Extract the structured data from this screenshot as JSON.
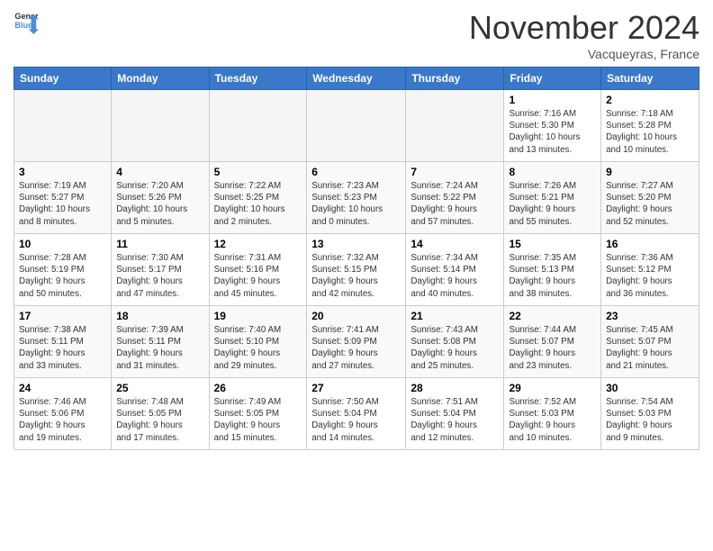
{
  "header": {
    "logo_general": "General",
    "logo_blue": "Blue",
    "month_title": "November 2024",
    "location": "Vacqueyras, France"
  },
  "weekdays": [
    "Sunday",
    "Monday",
    "Tuesday",
    "Wednesday",
    "Thursday",
    "Friday",
    "Saturday"
  ],
  "weeks": [
    [
      {
        "day": "",
        "info": ""
      },
      {
        "day": "",
        "info": ""
      },
      {
        "day": "",
        "info": ""
      },
      {
        "day": "",
        "info": ""
      },
      {
        "day": "",
        "info": ""
      },
      {
        "day": "1",
        "info": "Sunrise: 7:16 AM\nSunset: 5:30 PM\nDaylight: 10 hours\nand 13 minutes."
      },
      {
        "day": "2",
        "info": "Sunrise: 7:18 AM\nSunset: 5:28 PM\nDaylight: 10 hours\nand 10 minutes."
      }
    ],
    [
      {
        "day": "3",
        "info": "Sunrise: 7:19 AM\nSunset: 5:27 PM\nDaylight: 10 hours\nand 8 minutes."
      },
      {
        "day": "4",
        "info": "Sunrise: 7:20 AM\nSunset: 5:26 PM\nDaylight: 10 hours\nand 5 minutes."
      },
      {
        "day": "5",
        "info": "Sunrise: 7:22 AM\nSunset: 5:25 PM\nDaylight: 10 hours\nand 2 minutes."
      },
      {
        "day": "6",
        "info": "Sunrise: 7:23 AM\nSunset: 5:23 PM\nDaylight: 10 hours\nand 0 minutes."
      },
      {
        "day": "7",
        "info": "Sunrise: 7:24 AM\nSunset: 5:22 PM\nDaylight: 9 hours\nand 57 minutes."
      },
      {
        "day": "8",
        "info": "Sunrise: 7:26 AM\nSunset: 5:21 PM\nDaylight: 9 hours\nand 55 minutes."
      },
      {
        "day": "9",
        "info": "Sunrise: 7:27 AM\nSunset: 5:20 PM\nDaylight: 9 hours\nand 52 minutes."
      }
    ],
    [
      {
        "day": "10",
        "info": "Sunrise: 7:28 AM\nSunset: 5:19 PM\nDaylight: 9 hours\nand 50 minutes."
      },
      {
        "day": "11",
        "info": "Sunrise: 7:30 AM\nSunset: 5:17 PM\nDaylight: 9 hours\nand 47 minutes."
      },
      {
        "day": "12",
        "info": "Sunrise: 7:31 AM\nSunset: 5:16 PM\nDaylight: 9 hours\nand 45 minutes."
      },
      {
        "day": "13",
        "info": "Sunrise: 7:32 AM\nSunset: 5:15 PM\nDaylight: 9 hours\nand 42 minutes."
      },
      {
        "day": "14",
        "info": "Sunrise: 7:34 AM\nSunset: 5:14 PM\nDaylight: 9 hours\nand 40 minutes."
      },
      {
        "day": "15",
        "info": "Sunrise: 7:35 AM\nSunset: 5:13 PM\nDaylight: 9 hours\nand 38 minutes."
      },
      {
        "day": "16",
        "info": "Sunrise: 7:36 AM\nSunset: 5:12 PM\nDaylight: 9 hours\nand 36 minutes."
      }
    ],
    [
      {
        "day": "17",
        "info": "Sunrise: 7:38 AM\nSunset: 5:11 PM\nDaylight: 9 hours\nand 33 minutes."
      },
      {
        "day": "18",
        "info": "Sunrise: 7:39 AM\nSunset: 5:11 PM\nDaylight: 9 hours\nand 31 minutes."
      },
      {
        "day": "19",
        "info": "Sunrise: 7:40 AM\nSunset: 5:10 PM\nDaylight: 9 hours\nand 29 minutes."
      },
      {
        "day": "20",
        "info": "Sunrise: 7:41 AM\nSunset: 5:09 PM\nDaylight: 9 hours\nand 27 minutes."
      },
      {
        "day": "21",
        "info": "Sunrise: 7:43 AM\nSunset: 5:08 PM\nDaylight: 9 hours\nand 25 minutes."
      },
      {
        "day": "22",
        "info": "Sunrise: 7:44 AM\nSunset: 5:07 PM\nDaylight: 9 hours\nand 23 minutes."
      },
      {
        "day": "23",
        "info": "Sunrise: 7:45 AM\nSunset: 5:07 PM\nDaylight: 9 hours\nand 21 minutes."
      }
    ],
    [
      {
        "day": "24",
        "info": "Sunrise: 7:46 AM\nSunset: 5:06 PM\nDaylight: 9 hours\nand 19 minutes."
      },
      {
        "day": "25",
        "info": "Sunrise: 7:48 AM\nSunset: 5:05 PM\nDaylight: 9 hours\nand 17 minutes."
      },
      {
        "day": "26",
        "info": "Sunrise: 7:49 AM\nSunset: 5:05 PM\nDaylight: 9 hours\nand 15 minutes."
      },
      {
        "day": "27",
        "info": "Sunrise: 7:50 AM\nSunset: 5:04 PM\nDaylight: 9 hours\nand 14 minutes."
      },
      {
        "day": "28",
        "info": "Sunrise: 7:51 AM\nSunset: 5:04 PM\nDaylight: 9 hours\nand 12 minutes."
      },
      {
        "day": "29",
        "info": "Sunrise: 7:52 AM\nSunset: 5:03 PM\nDaylight: 9 hours\nand 10 minutes."
      },
      {
        "day": "30",
        "info": "Sunrise: 7:54 AM\nSunset: 5:03 PM\nDaylight: 9 hours\nand 9 minutes."
      }
    ]
  ]
}
